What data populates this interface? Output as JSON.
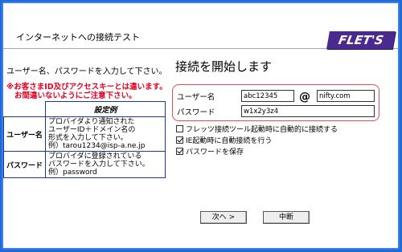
{
  "window": {
    "title": "インターネットへの接続テスト",
    "logo": "FLET'S"
  },
  "left": {
    "instruction": "ユーザー名、パスワードを入力して下さい。",
    "warning_lines": [
      "※お客さまID及びアクセスキーとは違います。",
      "お間違いないようにご注意下さい。"
    ],
    "example": {
      "header": "設定例",
      "rows": [
        {
          "label": "ユーザー名",
          "value_lines": [
            "プロバイダより通知された",
            "ユーザーID＋ドメイン名の",
            "形式を入力して下さい。",
            "例）tarou1234@isp-a.ne.jp"
          ]
        },
        {
          "label": "パスワード",
          "value_lines": [
            "プロバイダに登録されている",
            "パスワードを入力して下さい。",
            "例）password"
          ]
        }
      ]
    }
  },
  "form": {
    "heading": "接続を開始します",
    "username_label": "ユーザー名",
    "username_value": "abc12345",
    "at_symbol": "@",
    "domain_value": "nifty.com",
    "password_label": "パスワード",
    "password_value": "w1x2y3z4",
    "checkboxes": [
      {
        "label": "フレッツ接続ツール起動時に自動的に接続する",
        "checked": false
      },
      {
        "label": "IE起動時に自動接続を行う",
        "checked": true
      },
      {
        "label": "パスワードを保存",
        "checked": true
      }
    ]
  },
  "buttons": {
    "next": "次へ >",
    "cancel": "中断"
  }
}
